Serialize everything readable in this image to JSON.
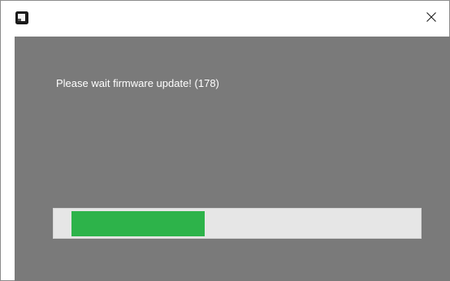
{
  "window": {
    "close_glyph": "✕"
  },
  "titlebar": {
    "app_icon": "app-window-icon",
    "close_icon": "close-icon"
  },
  "content": {
    "message": "Please wait firmware update! (178)"
  },
  "progress": {
    "fraction": 0.38,
    "fill_color": "#2db34a",
    "track_color": "#e6e6e6"
  },
  "colors": {
    "client_background": "#7a7a7a",
    "titlebar_background": "#ffffff"
  }
}
